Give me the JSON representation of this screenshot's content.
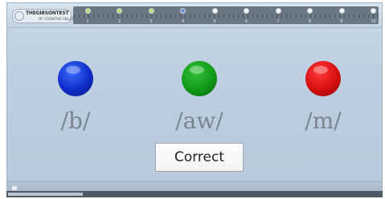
{
  "header": {
    "logo_text": "THEGIBSONTEST",
    "logo_tagline": "OF COGNITIVE SKILLS",
    "steps": [
      {
        "label": "1",
        "color": "#b8e07a"
      },
      {
        "label": "2",
        "color": "#b8e07a"
      },
      {
        "label": "3",
        "color": "#b8e07a"
      },
      {
        "label": "4",
        "color": "#6f8fd6"
      },
      {
        "label": "5",
        "color": "#f4f6f8"
      },
      {
        "label": "6",
        "color": "#f4f6f8"
      },
      {
        "label": "7",
        "color": "#f4f6f8"
      },
      {
        "label": "8",
        "color": "#f4f6f8"
      },
      {
        "label": "9",
        "color": "#f4f6f8"
      },
      {
        "label": "10",
        "color": "#f4f6f8"
      }
    ]
  },
  "tokens": [
    {
      "label": "/b/",
      "color": "blue",
      "colors": [
        "#3b6dff",
        "#0f2cc8",
        "#081a80"
      ]
    },
    {
      "label": "/aw/",
      "color": "green",
      "colors": [
        "#33c13a",
        "#119a18",
        "#07610b"
      ]
    },
    {
      "label": "/m/",
      "color": "red",
      "colors": [
        "#ff3b3b",
        "#d60f0f",
        "#8a0606"
      ]
    }
  ],
  "actions": {
    "correct_label": "Correct"
  },
  "footer": {
    "progress_fraction": 0.2
  }
}
